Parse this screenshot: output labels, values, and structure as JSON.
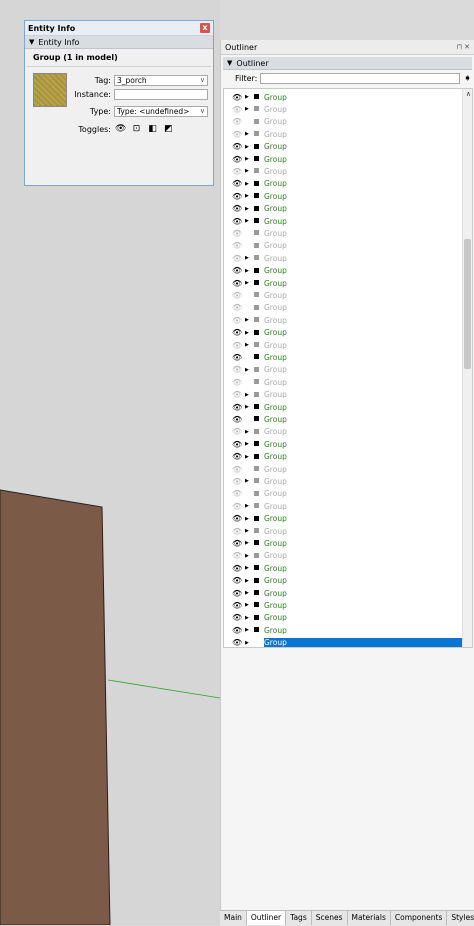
{
  "entity_info": {
    "title": "Entity Info",
    "close": "x",
    "section": "Entity Info",
    "summary": "Group (1 in model)",
    "tag_label": "Tag:",
    "tag_value": "3_porch",
    "instance_label": "Instance:",
    "instance_value": "",
    "type_label": "Type:",
    "type_value": "Type: <undefined>",
    "toggles_label": "Toggles:"
  },
  "outliner": {
    "title": "Outliner",
    "section": "Outliner",
    "filter_label": "Filter:",
    "filter_value": "",
    "rows": [
      {
        "name": "Group",
        "state": "vis",
        "expand": true
      },
      {
        "name": "Group",
        "state": "hid",
        "expand": true
      },
      {
        "name": "Group",
        "state": "hid",
        "expand": false
      },
      {
        "name": "Group",
        "state": "hid",
        "expand": true
      },
      {
        "name": "Group",
        "state": "vis",
        "expand": true
      },
      {
        "name": "Group",
        "state": "vis",
        "expand": true
      },
      {
        "name": "Group",
        "state": "hid",
        "expand": true
      },
      {
        "name": "Group",
        "state": "vis",
        "expand": true
      },
      {
        "name": "Group",
        "state": "vis",
        "expand": true
      },
      {
        "name": "Group",
        "state": "vis",
        "expand": true
      },
      {
        "name": "Group",
        "state": "vis",
        "expand": true
      },
      {
        "name": "Group",
        "state": "hid",
        "expand": false
      },
      {
        "name": "Group",
        "state": "hid",
        "expand": false
      },
      {
        "name": "Group",
        "state": "hid",
        "expand": true
      },
      {
        "name": "Group",
        "state": "vis",
        "expand": true
      },
      {
        "name": "Group",
        "state": "vis",
        "expand": true
      },
      {
        "name": "Group",
        "state": "hid",
        "expand": false
      },
      {
        "name": "Group",
        "state": "hid",
        "expand": false
      },
      {
        "name": "Group",
        "state": "hid",
        "expand": true
      },
      {
        "name": "Group",
        "state": "vis",
        "expand": true
      },
      {
        "name": "Group",
        "state": "hid",
        "expand": true
      },
      {
        "name": "Group",
        "state": "vis",
        "expand": false
      },
      {
        "name": "Group",
        "state": "hid",
        "expand": true
      },
      {
        "name": "Group",
        "state": "hid",
        "expand": false
      },
      {
        "name": "Group",
        "state": "hid",
        "expand": true
      },
      {
        "name": "Group",
        "state": "vis",
        "expand": true
      },
      {
        "name": "Group",
        "state": "vis",
        "expand": false
      },
      {
        "name": "Group",
        "state": "hid",
        "expand": true
      },
      {
        "name": "Group",
        "state": "vis",
        "expand": true
      },
      {
        "name": "Group",
        "state": "vis",
        "expand": true
      },
      {
        "name": "Group",
        "state": "hid",
        "expand": false
      },
      {
        "name": "Group",
        "state": "hid",
        "expand": true
      },
      {
        "name": "Group",
        "state": "hid",
        "expand": false
      },
      {
        "name": "Group",
        "state": "hid",
        "expand": true
      },
      {
        "name": "Group",
        "state": "vis",
        "expand": true
      },
      {
        "name": "Group",
        "state": "hid",
        "expand": true
      },
      {
        "name": "Group",
        "state": "vis",
        "expand": true
      },
      {
        "name": "Group",
        "state": "hid",
        "expand": true
      },
      {
        "name": "Group",
        "state": "vis",
        "expand": true
      },
      {
        "name": "Group",
        "state": "vis",
        "expand": true
      },
      {
        "name": "Group",
        "state": "vis",
        "expand": true
      },
      {
        "name": "Group",
        "state": "vis",
        "expand": true
      },
      {
        "name": "Group",
        "state": "vis",
        "expand": true
      },
      {
        "name": "Group",
        "state": "vis",
        "expand": true
      },
      {
        "name": "Group",
        "state": "sel",
        "expand": true
      },
      {
        "name": "Group",
        "state": "vis",
        "expand": true
      }
    ]
  },
  "tabs": [
    "Main",
    "Outliner",
    "Tags",
    "Scenes",
    "Materials",
    "Components",
    "Styles"
  ],
  "active_tab": "Outliner",
  "colors": {
    "selection": "#0a74d1",
    "visible_text": "#2e7d1e",
    "hidden_text": "#a9a9a9",
    "wall": "#7b5a47"
  }
}
